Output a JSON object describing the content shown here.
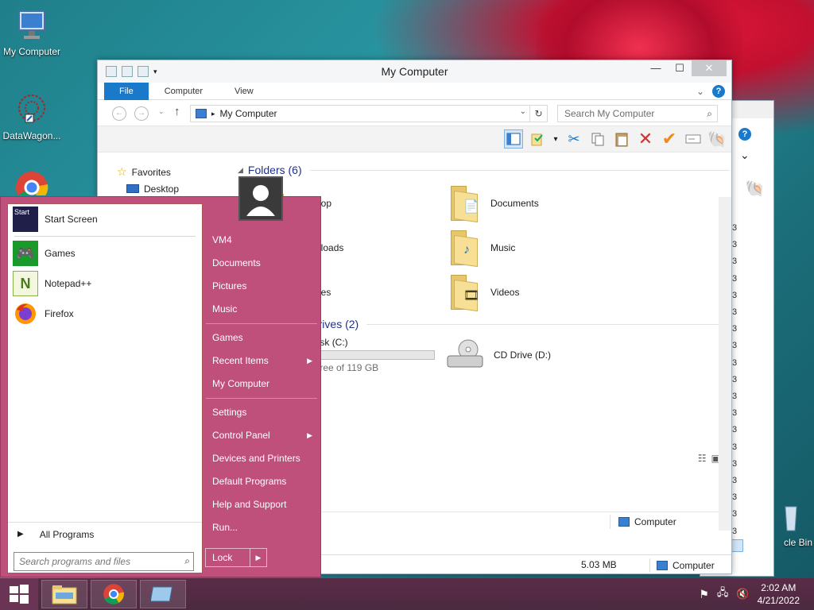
{
  "desktop": {
    "icons": [
      {
        "label": "My Computer"
      },
      {
        "label": "DataWagon..."
      },
      {
        "label": "cle Bin"
      }
    ]
  },
  "back_window": {
    "numbers": [
      "3",
      "3",
      "3",
      "3",
      "3",
      "3",
      "3",
      "3",
      "3",
      "3",
      "3",
      "3",
      "3",
      "3",
      "3",
      "3",
      "3",
      "3",
      "3",
      "3"
    ]
  },
  "explorer": {
    "title": "My Computer",
    "tabs": [
      {
        "label": "File"
      },
      {
        "label": "Computer"
      },
      {
        "label": "View"
      }
    ],
    "address": "My Computer",
    "search_placeholder": "Search My Computer",
    "nav": [
      {
        "label": "Favorites"
      },
      {
        "label": "Desktop"
      }
    ],
    "folders_header": "Folders (6)",
    "folders": [
      {
        "label": "Desktop"
      },
      {
        "label": "Documents"
      },
      {
        "label": "Downloads"
      },
      {
        "label": "Music"
      },
      {
        "label": "Pictures"
      },
      {
        "label": "Videos"
      }
    ],
    "drives_header": "Devices and drives (2)",
    "drives": [
      {
        "label": "Local Disk (C:)",
        "detail": "free of 119 GB",
        "used_fraction": 0.12
      },
      {
        "label": "CD Drive (D:)"
      }
    ],
    "inner_status_location": "Computer",
    "status_size": "5.03 MB",
    "status_location": "Computer"
  },
  "start_menu": {
    "programs": [
      {
        "label": "Start Screen",
        "icon": "start-screen-icon"
      },
      {
        "label": "Games",
        "icon": "games-icon"
      },
      {
        "label": "Notepad++",
        "icon": "notepad-icon"
      },
      {
        "label": "Firefox",
        "icon": "firefox-icon"
      }
    ],
    "all_programs": "All Programs",
    "search_placeholder": "Search programs and files",
    "right_items": [
      {
        "label": "VM4"
      },
      {
        "label": "Documents"
      },
      {
        "label": "Pictures"
      },
      {
        "label": "Music"
      },
      {
        "label": "Games"
      },
      {
        "label": "Recent Items",
        "submenu": true
      },
      {
        "label": "My Computer"
      },
      {
        "label": "Settings"
      },
      {
        "label": "Control Panel",
        "submenu": true
      },
      {
        "label": "Devices and Printers"
      },
      {
        "label": "Default Programs"
      },
      {
        "label": "Help and Support"
      },
      {
        "label": "Run..."
      }
    ],
    "lock_label": "Lock",
    "icon_start_text": "Start"
  },
  "taskbar": {
    "time": "2:02 AM",
    "date": "4/21/2022"
  }
}
